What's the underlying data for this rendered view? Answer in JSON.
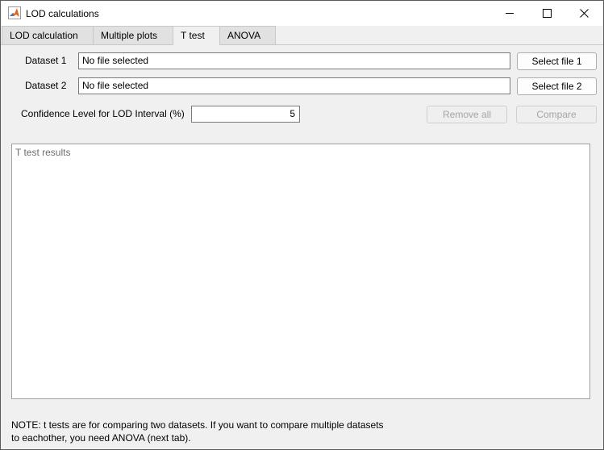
{
  "window": {
    "title": "LOD calculations"
  },
  "icons": {
    "app": "matlab-logo-icon",
    "minimize": "minimize-icon",
    "maximize": "maximize-icon",
    "close": "close-icon"
  },
  "tabs": [
    {
      "label": "LOD calculation",
      "active": false
    },
    {
      "label": "Multiple plots",
      "active": false
    },
    {
      "label": "T test",
      "active": true
    },
    {
      "label": "ANOVA",
      "active": false
    }
  ],
  "dataset1": {
    "label": "Dataset 1",
    "value": "No file selected",
    "button": "Select file 1"
  },
  "dataset2": {
    "label": "Dataset 2",
    "value": "No file selected",
    "button": "Select file 2"
  },
  "confidence": {
    "label": "Confidence Level for LOD Interval (%)",
    "value": "5"
  },
  "actions": {
    "remove_all": "Remove all",
    "compare": "Compare"
  },
  "results": {
    "text": "T test results"
  },
  "note": {
    "line1": "NOTE: t tests are for comparing two datasets. If you want to compare multiple datasets",
    "line2": "to eachother, you need ANOVA (next tab)."
  }
}
